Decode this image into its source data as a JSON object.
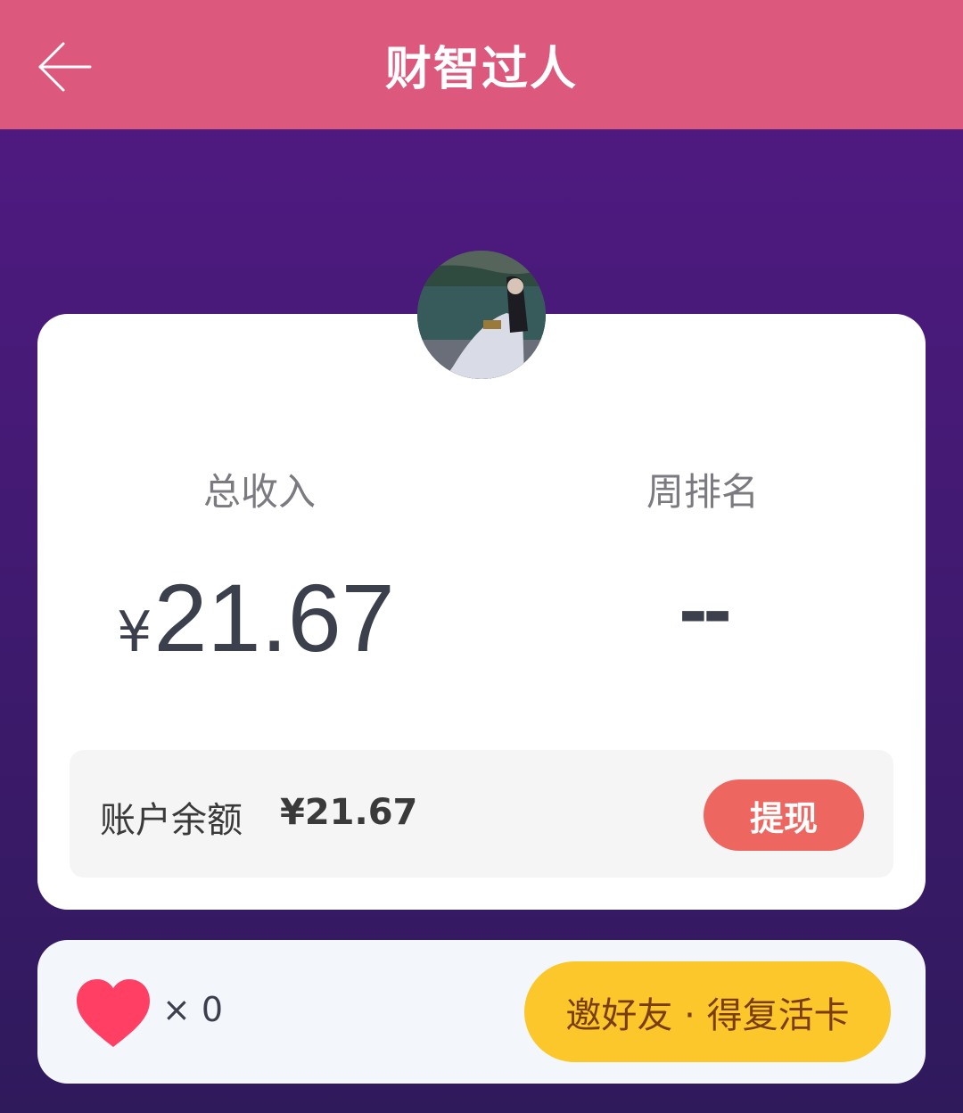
{
  "header": {
    "title": "财智过人",
    "back_icon": "arrow-left-icon"
  },
  "stats": {
    "income_label": "总收入",
    "rank_label": "周排名",
    "income_currency": "¥",
    "income_value": "21.67",
    "rank_value": "--"
  },
  "balance": {
    "label": "账户余额",
    "amount": "¥21.67",
    "withdraw_label": "提现"
  },
  "lives": {
    "icon": "heart-icon",
    "count_text": "× 0"
  },
  "invite": {
    "label": "邀好友 · 得复活卡"
  },
  "colors": {
    "header_bg": "#dc597d",
    "page_bg_top": "#531a85",
    "page_bg_bottom": "#2f1a5c",
    "withdraw_btn": "#ee6660",
    "invite_btn": "#fcc72b",
    "heart": "#ff3f63"
  }
}
